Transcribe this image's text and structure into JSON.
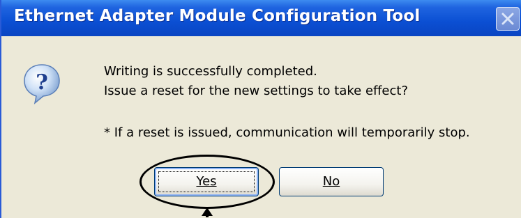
{
  "dialog": {
    "title": "Ethernet Adapter Module Configuration Tool",
    "close_icon": "close-icon",
    "icon": "question-icon",
    "message_line_1": "Writing is successfully completed.",
    "message_line_2": "Issue a reset for the new settings to take effect?",
    "note": "* If a reset is issued, communication will temporarily stop.",
    "buttons": {
      "yes_label": "Yes",
      "no_label": "No"
    }
  },
  "annotation": {
    "highlight": "ellipse around Yes button",
    "pointer": "arrow"
  }
}
